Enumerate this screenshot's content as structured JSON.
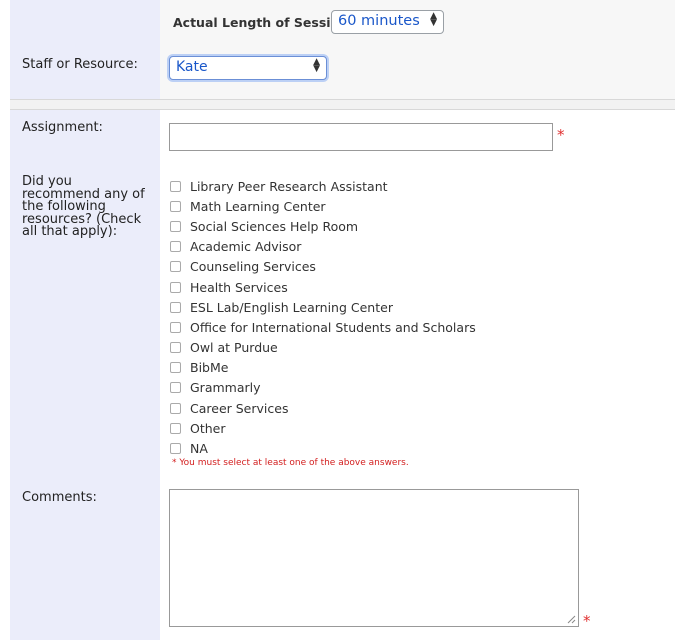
{
  "session": {
    "label": "Actual Length of Session:",
    "value": "60 minutes"
  },
  "staff": {
    "label": "Staff or Resource:",
    "value": "Kate"
  },
  "assignment": {
    "label": "Assignment:",
    "value": "",
    "required_mark": "*"
  },
  "resources": {
    "label_lines": [
      "Did you",
      "recommend any of",
      "the following",
      "resources? (Check",
      "all that apply):"
    ],
    "options": [
      "Library Peer Research Assistant",
      "Math Learning Center",
      "Social Sciences Help Room",
      "Academic Advisor",
      "Counseling Services",
      "Health Services",
      "ESL Lab/English Learning Center",
      "Office for International Students and Scholars",
      "Owl at Purdue",
      "BibMe",
      "Grammarly",
      "Career Services",
      "Other",
      "NA"
    ],
    "error": "* You must select at least one of the above answers."
  },
  "comments": {
    "label": "Comments:",
    "value": "",
    "required_mark": "*"
  },
  "colors": {
    "label_bg": "#ebedfa",
    "required": "#e03030",
    "select_text": "#1a57c9"
  }
}
